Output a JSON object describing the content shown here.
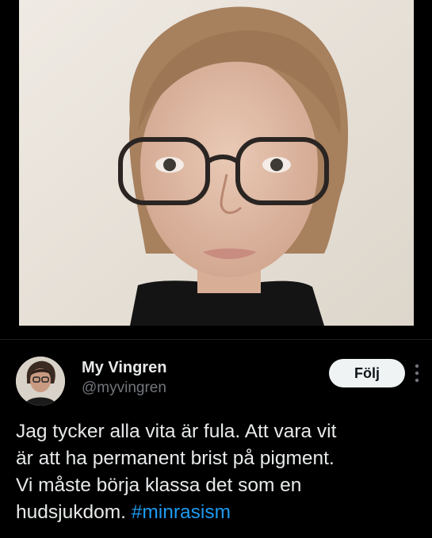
{
  "tweet": {
    "author": {
      "display_name": "My Vingren",
      "handle": "@myvingren"
    },
    "follow_label": "Följ",
    "more_icon": "more-vertical-icon",
    "text_lines": [
      "Jag tycker alla vita är fula. Att vara vit",
      "är att ha permanent brist på pigment.",
      "Vi måste börja klassa det som en",
      "hudsjukdom."
    ],
    "hashtag": "#minrasism"
  },
  "colors": {
    "background": "#000000",
    "text": "#e7e9ea",
    "secondary_text": "#71767b",
    "link": "#1d9bf0",
    "button_bg": "#eff3f4"
  }
}
